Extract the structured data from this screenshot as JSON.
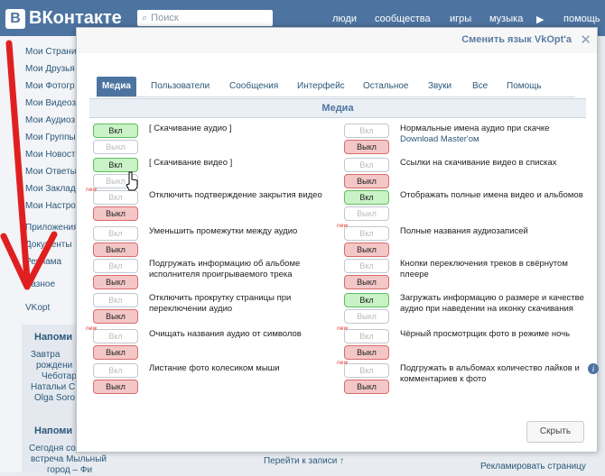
{
  "header": {
    "logo_text": "ВКонтакте",
    "logo_letter": "В",
    "search_placeholder": "Поиск",
    "nav": [
      "люди",
      "сообщества",
      "игры",
      "музыка",
      "помощь"
    ]
  },
  "sidebar": {
    "items": [
      "Мои Страни",
      "Мои Друзья",
      "Мои Фотогр",
      "Мои Видеоз",
      "Мои Аудиоз",
      "Мои Группы",
      "Мои Новости",
      "Мои Ответы",
      "Мои Заклад",
      "Мои Настро",
      "Приложения",
      "Документы",
      "Реклама",
      "Разное",
      "VKopt"
    ]
  },
  "reminders": [
    {
      "title": "Напоми",
      "lines": [
        "Завтра",
        "рождени",
        "Чеботар",
        "Натальи С",
        "Olga Soro"
      ]
    },
    {
      "title": "Напоми",
      "lines": [
        "Сегодня со",
        "встреча Мыльный",
        "город – Фи"
      ]
    }
  ],
  "bottom": {
    "next_posts": "Перейти к записи ↑",
    "advertise": "Рекламировать страницу"
  },
  "dialog": {
    "change_language": "Сменить язык VkOpt'a",
    "close_label": "✕",
    "tabs": [
      "Медиа",
      "Пользователи",
      "Сообщения",
      "Интерфейс",
      "Остальное",
      "Звуки",
      "Все",
      "Помощь"
    ],
    "active_tab": "Медиа",
    "section_title": "Медиа",
    "on_label": "Вкл",
    "off_label": "Выкл",
    "new_badge": "new",
    "left_options": [
      {
        "text": "[ Скачивание аудио ]",
        "state": "on",
        "new": false
      },
      {
        "text": "[ Скачивание видео ]",
        "state": "on",
        "new": false
      },
      {
        "text": "Отключить подтверждение закрытия видео",
        "state": "off",
        "new": true
      },
      {
        "text": "Уменьшить промежутки между аудио",
        "state": "off",
        "new": false
      },
      {
        "text": "Подгружать информацию об альбоме исполнителя проигрываемого трека",
        "state": "off",
        "new": false
      },
      {
        "text": "Отключить прокрутку страницы при переключении аудио",
        "state": "off",
        "new": false
      },
      {
        "text": "Очищать названия аудио от символов",
        "state": "off",
        "new": true
      },
      {
        "text": "Листание фото колесиком мыши",
        "state": "off",
        "new": false
      }
    ],
    "right_options": [
      {
        "text": "Нормальные имена аудио при скачке",
        "sub": "Download Master'ом",
        "state": "off",
        "new": false
      },
      {
        "text": "Ссылки на скачивание видео в списках",
        "sub": "",
        "state": "off",
        "new": false
      },
      {
        "text": "Отображать полные имена видео и альбомов",
        "sub": "",
        "state": "on",
        "new": false
      },
      {
        "text": "Полные названия аудиозаписей",
        "sub": "",
        "state": "off",
        "new": true
      },
      {
        "text": "Кнопки переключения треков в свёрнутом плеере",
        "sub": "",
        "state": "off",
        "new": false
      },
      {
        "text": "Загружать информацию о размере и качестве аудио при наведении на иконку скачивания",
        "sub": "",
        "state": "on",
        "new": false
      },
      {
        "text": "Чёрный просмотрщик фото в режиме ночь",
        "sub": "",
        "state": "off",
        "new": true
      },
      {
        "text": "Подгружать в альбомах количество лайков и комментариев к фото",
        "sub": "",
        "state": "off",
        "new": true,
        "info": "i"
      }
    ],
    "hide_button": "Скрыть"
  },
  "colors": {
    "brand": "#4d74a0",
    "on": "#c9f2c7",
    "off": "#f4c7c7",
    "arrow": "#e02020"
  }
}
